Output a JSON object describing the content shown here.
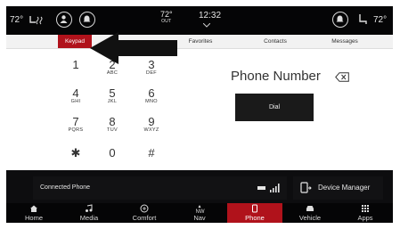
{
  "status": {
    "left_temp": "72°",
    "outside_temp": "72°",
    "outside_label": "OUT",
    "time": "12:32",
    "right_temp": "72°"
  },
  "tabs": [
    {
      "label": "Keypad",
      "active": true
    },
    {
      "label": "Favorites",
      "active": false
    },
    {
      "label": "Contacts",
      "active": false
    },
    {
      "label": "Messages",
      "active": false
    }
  ],
  "keypad": [
    {
      "digit": "1",
      "letters": ""
    },
    {
      "digit": "2",
      "letters": "ABC"
    },
    {
      "digit": "3",
      "letters": "DEF"
    },
    {
      "digit": "4",
      "letters": "GHI"
    },
    {
      "digit": "5",
      "letters": "JKL"
    },
    {
      "digit": "6",
      "letters": "MNO"
    },
    {
      "digit": "7",
      "letters": "PQRS"
    },
    {
      "digit": "8",
      "letters": "TUV"
    },
    {
      "digit": "9",
      "letters": "WXYZ"
    },
    {
      "digit": "✱",
      "letters": ""
    },
    {
      "digit": "0",
      "letters": ""
    },
    {
      "digit": "#",
      "letters": ""
    }
  ],
  "phone_number_label": "Phone Number",
  "dial_label": "Dial",
  "connected_phone_label": "Connected Phone",
  "device_manager_label": "Device Manager",
  "nav": [
    {
      "label": "Home",
      "icon": "home-icon",
      "active": false
    },
    {
      "label": "Media",
      "icon": "music-note-icon",
      "active": false
    },
    {
      "label": "Comfort",
      "icon": "comfort-icon",
      "active": false
    },
    {
      "label": "Nav",
      "icon": "compass-icon",
      "active": false
    },
    {
      "label": "Phone",
      "icon": "phone-icon",
      "active": true
    },
    {
      "label": "Vehicle",
      "icon": "vehicle-icon",
      "active": false
    },
    {
      "label": "Apps",
      "icon": "apps-grid-icon",
      "active": false
    }
  ],
  "colors": {
    "accent": "#b0121b",
    "background": "#0d0d0f"
  }
}
